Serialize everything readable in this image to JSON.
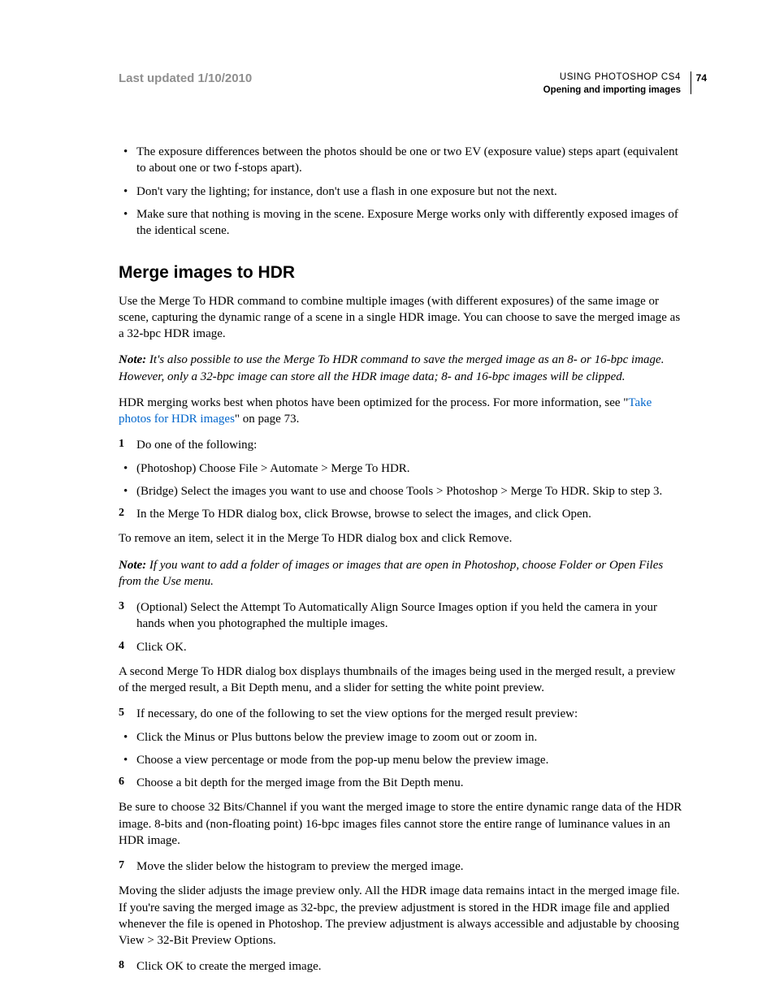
{
  "header": {
    "last_updated": "Last updated 1/10/2010",
    "doc_title": "USING PHOTOSHOP CS4",
    "section_title": "Opening and importing images",
    "page_number": "74"
  },
  "top_bullets": [
    "The exposure differences between the photos should be one or two EV (exposure value) steps apart (equivalent to about one or two f-stops apart).",
    "Don't vary the lighting; for instance, don't use a flash in one exposure but not the next.",
    "Make sure that nothing is moving in the scene. Exposure Merge works only with differently exposed images of the identical scene."
  ],
  "heading": "Merge images to HDR",
  "intro": "Use the Merge To HDR command to combine multiple images (with different exposures) of the same image or scene, capturing the dynamic range of a scene in a single HDR image. You can choose to save the merged image as a 32-bpc HDR image.",
  "note1_label": "Note:",
  "note1_body": " It's also possible to use the Merge To HDR command to save the merged image as an 8- or 16-bpc image. However, only a 32-bpc image can store all the HDR image data; 8- and 16-bpc images will be clipped.",
  "para_link_pre": "HDR merging works best when photos have been optimized for the process. For more information, see \"",
  "link_text": "Take photos for HDR images",
  "para_link_post": "\" on page 73.",
  "step1_num": "1",
  "step1": "Do one of the following:",
  "step1_bullets": [
    "(Photoshop) Choose File > Automate > Merge To HDR.",
    "(Bridge) Select the images you want to use and choose Tools > Photoshop > Merge To HDR. Skip to step 3."
  ],
  "step2_num": "2",
  "step2": "In the Merge To HDR dialog box, click Browse, browse to select the images, and click Open.",
  "remove_para": "To remove an item, select it in the Merge To HDR dialog box and click Remove.",
  "note2_label": "Note:",
  "note2_body": " If you want to add a folder of images or images that are open in Photoshop, choose Folder or Open Files from the Use menu.",
  "step3_num": "3",
  "step3": "(Optional) Select the Attempt To Automatically Align Source Images option if you held the camera in your hands when you photographed the multiple images.",
  "step4_num": "4",
  "step4": "Click OK.",
  "second_dialog": "A second Merge To HDR dialog box displays thumbnails of the images being used in the merged result, a preview of the merged result, a Bit Depth menu, and a slider for setting the white point preview.",
  "step5_num": "5",
  "step5": "If necessary, do one of the following to set the view options for the merged result preview:",
  "step5_bullets": [
    "Click the Minus or Plus buttons below the preview image to zoom out or zoom in.",
    "Choose a view percentage or mode from the pop-up menu below the preview image."
  ],
  "step6_num": "6",
  "step6": "Choose a bit depth for the merged image from the Bit Depth menu.",
  "bitdepth_para": "Be sure to choose 32 Bits/Channel if you want the merged image to store the entire dynamic range data of the HDR image. 8-bits and (non-floating point) 16-bpc images files cannot store the entire range of luminance values in an HDR image.",
  "step7_num": "7",
  "step7": "Move the slider below the histogram to preview the merged image.",
  "slider_para": "Moving the slider adjusts the image preview only. All the HDR image data remains intact in the merged image file. If you're saving the merged image as 32-bpc, the preview adjustment is stored in the HDR image file and applied whenever the file is opened in Photoshop. The preview adjustment is always accessible and adjustable by choosing View > 32-Bit Preview Options.",
  "step8_num": "8",
  "step8": "Click OK to create the merged image."
}
